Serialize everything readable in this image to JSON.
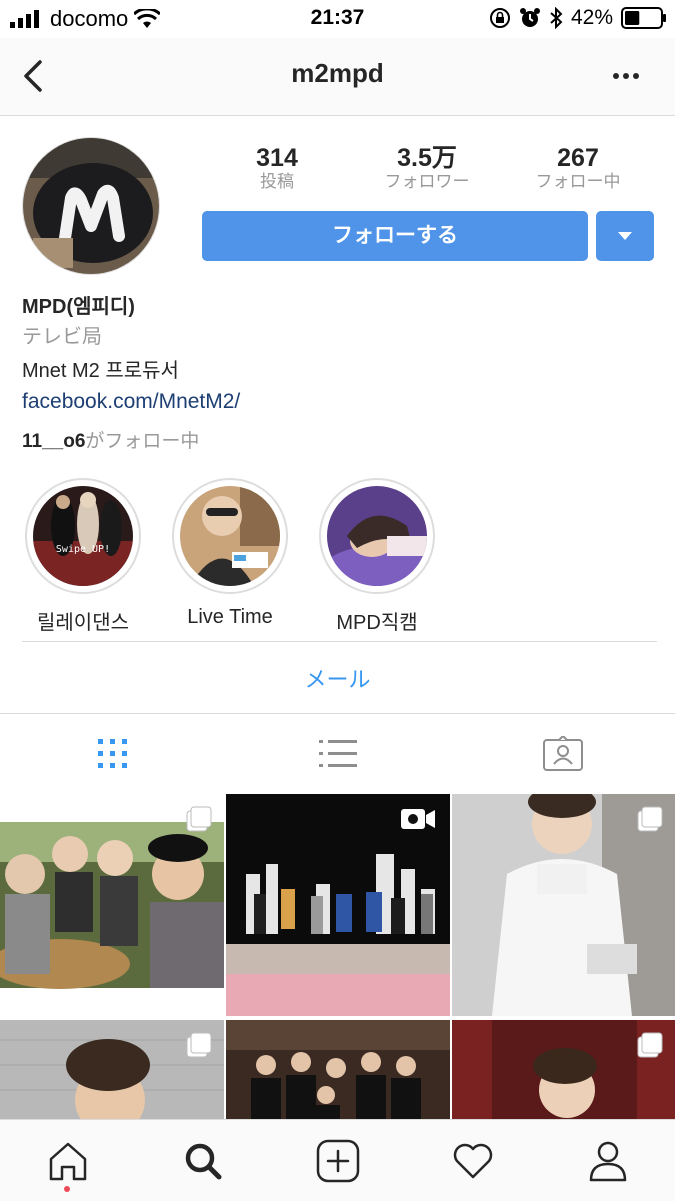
{
  "status_bar": {
    "carrier": "docomo",
    "time": "21:37",
    "battery": "42%",
    "battery_level": 0.42
  },
  "nav": {
    "title": "m2mpd"
  },
  "profile": {
    "stats": [
      {
        "value": "314",
        "label": "投稿"
      },
      {
        "value": "3.5万",
        "label": "フォロワー"
      },
      {
        "value": "267",
        "label": "フォロー中"
      }
    ],
    "follow_label": "フォローする",
    "name": "MPD(엠피디)",
    "category": "テレビ局",
    "bio": "Mnet M2 프로듀서",
    "link": "facebook.com/MnetM2/",
    "followed_by_user": "11__o6",
    "followed_by_suffix": "がフォロー中"
  },
  "highlights": [
    {
      "label": "릴레이댄스",
      "overlay": "Swipe UP!"
    },
    {
      "label": "Live Time"
    },
    {
      "label": "MPD직캠"
    }
  ],
  "contact": {
    "email_label": "メール"
  },
  "icons": {
    "grid": "grid-icon",
    "list": "list-icon",
    "tagged": "tagged-icon",
    "home": "home-icon",
    "search": "search-icon",
    "add": "add-post-icon",
    "activity": "heart-icon",
    "profile": "profile-icon"
  },
  "colors": {
    "accent": "#3897f0",
    "button": "#4f94e8",
    "link": "#1d3f73"
  }
}
